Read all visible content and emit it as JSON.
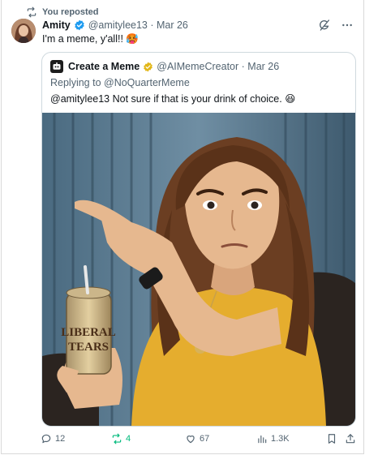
{
  "repost_banner": {
    "text": "You reposted",
    "icon": "repost-icon"
  },
  "tweet": {
    "author": "Amity",
    "handle": "@amitylee13",
    "date": "Mar 26",
    "text": "I'm a meme, y'all!! 🥵",
    "verified": true,
    "icons": [
      "grok-icon",
      "more-icon"
    ]
  },
  "quoted": {
    "author": "Create a Meme",
    "handle": "@AIMemeCreator",
    "date": "Mar 26",
    "reply_prefix": "Replying to ",
    "reply_handle": "@NoQuarterMeme",
    "text": "@amitylee13 Not sure if that is your drink of choice. 😆",
    "image_can_text": [
      "LIBERAL",
      "TEARS"
    ]
  },
  "actions": {
    "replies": "12",
    "reposts": "4",
    "likes": "67",
    "views": "1.3K"
  },
  "colors": {
    "repost_active": "#00ba7c",
    "muted": "#536471",
    "verified_blue": "#1d9bf0",
    "gold_badge": "#e2b719"
  }
}
